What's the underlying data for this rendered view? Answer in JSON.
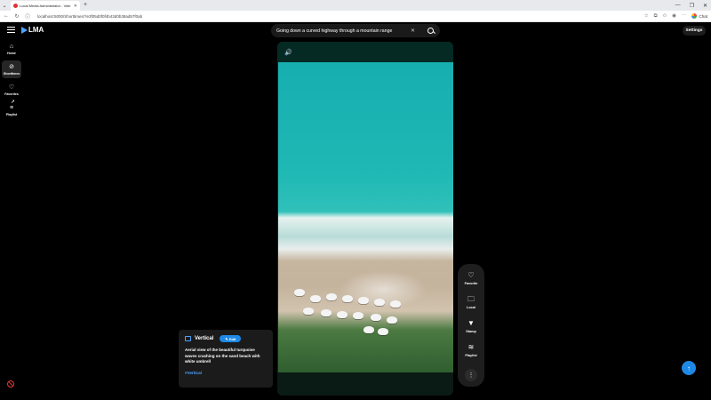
{
  "browser": {
    "tab_title": "Local Media Administrator - Vide",
    "url": "localhost:5000/Shorttimes/?e3f05d0f0f4b43d0b38ad57f0ab",
    "chat_label": "Chat"
  },
  "app": {
    "logo": "LMA",
    "search": {
      "value": "Going down a curved highway through a mountain range"
    },
    "settings_label": "Settings"
  },
  "sidebar": {
    "items": [
      {
        "label": "Home",
        "icon": "home-icon"
      },
      {
        "label": "Shorttimes",
        "icon": "compass-icon"
      },
      {
        "label": "Favorites",
        "icon": "heart-icon"
      },
      {
        "label": "Playlist",
        "icon": "playlist-icon"
      }
    ]
  },
  "info": {
    "title": "Vertical",
    "edit_label": "Edit",
    "description": "Aerial view of the beautiful turquoise waves crashing on the sand beach with white umbrell",
    "tag": "#Vertical"
  },
  "rail": {
    "items": [
      {
        "label": "Favorite",
        "icon": "heart-icon"
      },
      {
        "label": "Local",
        "icon": "folder-icon"
      },
      {
        "label": "Stamp",
        "icon": "stamp-icon"
      },
      {
        "label": "Playlist",
        "icon": "playlist-icon"
      }
    ]
  },
  "colors": {
    "accent": "#1e88e5",
    "danger": "#e53935"
  }
}
